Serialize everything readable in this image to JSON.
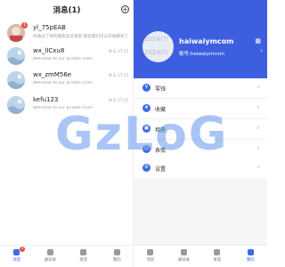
{
  "messages_screen": {
    "title": "消息(1)",
    "add_icon": "plus-circle-icon",
    "chats": [
      {
        "name": "yl_75pEAB",
        "preview": "你通过了你的朋友验证请求,现在我们可以开始聊天了",
        "time": "",
        "unread": "1"
      },
      {
        "name": "wx_lICxu8",
        "preview": "Welcome to our private chat!",
        "time": "昨天 17:15",
        "unread": ""
      },
      {
        "name": "wx_zmM56e",
        "preview": "Welcome to our private chat!",
        "time": "昨天 17:15",
        "unread": ""
      },
      {
        "name": "kefu123",
        "preview": "Welcome to our private chat!",
        "time": "昨天 17:15",
        "unread": ""
      }
    ],
    "tabbar": [
      {
        "label": "消息",
        "icon": "chat-icon",
        "badge": "1",
        "active": true
      },
      {
        "label": "通讯录",
        "icon": "contacts-icon",
        "badge": "",
        "active": false
      },
      {
        "label": "发现",
        "icon": "discover-icon",
        "badge": "",
        "active": false
      },
      {
        "label": "我的",
        "icon": "user-icon",
        "badge": "",
        "active": false
      }
    ]
  },
  "profile_screen": {
    "avatar_text_1": "2024/7/",
    "avatar_text_2": "2024/7/",
    "name": "haiwaiymcom",
    "account": "账号:haiwaiymcom",
    "menu": [
      {
        "label": "零钱",
        "icon": "wallet-icon",
        "glyph": "¥"
      },
      {
        "label": "收藏",
        "icon": "star-icon",
        "glyph": "★"
      },
      {
        "label": "相册",
        "icon": "album-icon",
        "glyph": "▣"
      },
      {
        "label": "表情",
        "icon": "emoji-icon",
        "glyph": "☺"
      },
      {
        "label": "设置",
        "icon": "gear-icon",
        "glyph": "⚙"
      }
    ],
    "tabbar": [
      {
        "label": "消息",
        "icon": "chat-icon",
        "active": false
      },
      {
        "label": "通讯录",
        "icon": "contacts-icon",
        "active": false
      },
      {
        "label": "发现",
        "icon": "discover-icon",
        "active": false
      },
      {
        "label": "我的",
        "icon": "user-icon",
        "active": true
      }
    ]
  },
  "watermark": "GzLoG",
  "colors": {
    "brand_blue": "#3d5fdf",
    "badge_red": "#f24a4a",
    "watermark": "#6496ec"
  }
}
